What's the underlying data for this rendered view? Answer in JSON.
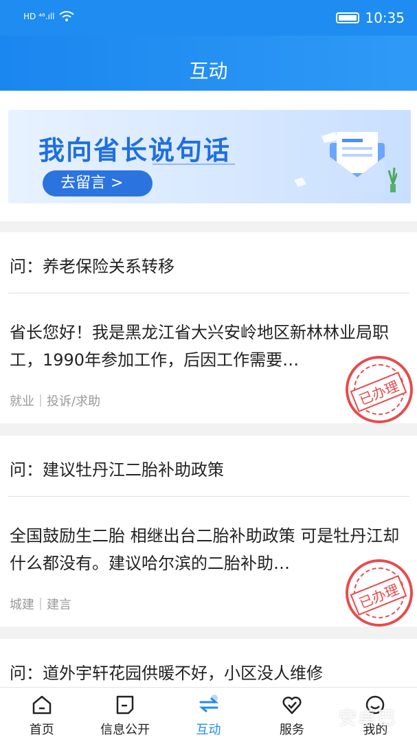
{
  "status": {
    "left_text": "HD ⁴⁶.ıll",
    "time": "10:35"
  },
  "header": {
    "title": "互动"
  },
  "banner": {
    "title": "我向省长说句话",
    "button_label": "去留言 >"
  },
  "items": [
    {
      "question": "问：养老保险关系转移",
      "body": "省长您好！我是黑龙江省大兴安岭地区新林林业局职工，1990年参加工作，后因工作需要…",
      "tags": "就业｜投诉/求助",
      "stamp": "已办理"
    },
    {
      "question": "问：建议牡丹江二胎补助政策",
      "body": "全国鼓励生二胎 相继出台二胎补助政策 可是牡丹江却什么都没有。建议哈尔滨的二胎补助…",
      "tags": "城建｜建言",
      "stamp": "已办理"
    },
    {
      "question": "问：道外宇轩花园供暖不好，小区没人维修"
    }
  ],
  "tabbar": {
    "tabs": [
      {
        "label": "首页",
        "icon": "home-icon"
      },
      {
        "label": "信息公开",
        "icon": "document-icon"
      },
      {
        "label": "互动",
        "icon": "interaction-icon"
      },
      {
        "label": "服务",
        "icon": "heart-check-icon"
      },
      {
        "label": "我的",
        "icon": "profile-icon"
      }
    ]
  },
  "watermark": "安卓巴",
  "colors": {
    "primary": "#1e8cf0",
    "stamp": "#e84b4b"
  }
}
